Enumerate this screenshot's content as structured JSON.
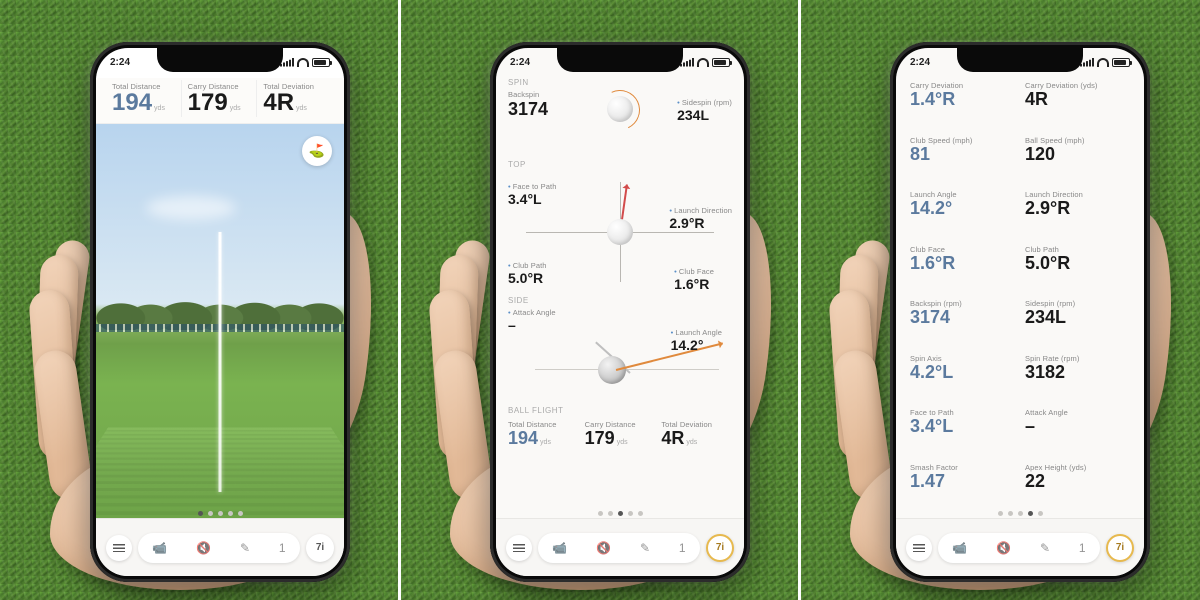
{
  "status": {
    "time": "2:24"
  },
  "dock": {
    "shot_count": "1",
    "club": "7i"
  },
  "phone1": {
    "metrics": [
      {
        "label": "Total Distance",
        "value": "194",
        "unit": "yds"
      },
      {
        "label": "Carry Distance",
        "value": "179",
        "unit": "yds"
      },
      {
        "label": "Total Deviation",
        "value": "4R",
        "unit": "yds"
      }
    ],
    "active_page_index": 0
  },
  "phone2": {
    "sections": {
      "spin": "SPIN",
      "top": "TOP",
      "side": "SIDE",
      "ballflight": "BALL FLIGHT"
    },
    "spin": {
      "backspin": {
        "label": "Backspin",
        "value": "3174"
      },
      "sidespin": {
        "label": "Sidespin (rpm)",
        "value": "234L"
      }
    },
    "top": {
      "face_to_path": {
        "label": "Face to Path",
        "value": "3.4°L"
      },
      "launch_direction": {
        "label": "Launch Direction",
        "value": "2.9°R"
      },
      "club_path": {
        "label": "Club Path",
        "value": "5.0°R"
      },
      "club_face": {
        "label": "Club Face",
        "value": "1.6°R"
      }
    },
    "side": {
      "attack_angle": {
        "label": "Attack Angle",
        "value": "–"
      },
      "launch_angle": {
        "label": "Launch Angle",
        "value": "14.2°"
      }
    },
    "ballflight": {
      "total_distance": {
        "label": "Total Distance",
        "value": "194",
        "unit": "yds"
      },
      "carry_distance": {
        "label": "Carry Distance",
        "value": "179",
        "unit": "yds"
      },
      "total_deviation": {
        "label": "Total Deviation",
        "value": "4R",
        "unit": "yds"
      }
    },
    "active_page_index": 2
  },
  "phone3": {
    "left": [
      {
        "label": "Carry Deviation",
        "value": "1.4°R",
        "dim": true
      },
      {
        "label": "Club Speed (mph)",
        "value": "81",
        "dim": true
      },
      {
        "label": "Launch Angle",
        "value": "14.2°",
        "dim": true
      },
      {
        "label": "Club Face",
        "value": "1.6°R",
        "dim": true
      },
      {
        "label": "Backspin (rpm)",
        "value": "3174",
        "dim": true
      },
      {
        "label": "Spin Axis",
        "value": "4.2°L",
        "dim": true
      },
      {
        "label": "Face to Path",
        "value": "3.4°L",
        "dim": true
      },
      {
        "label": "Smash Factor",
        "value": "1.47",
        "dim": true
      }
    ],
    "right": [
      {
        "label": "Carry Deviation (yds)",
        "value": "4R"
      },
      {
        "label": "Ball Speed (mph)",
        "value": "120"
      },
      {
        "label": "Launch Direction",
        "value": "2.9°R"
      },
      {
        "label": "Club Path",
        "value": "5.0°R"
      },
      {
        "label": "Sidespin (rpm)",
        "value": "234L"
      },
      {
        "label": "Spin Rate (rpm)",
        "value": "3182"
      },
      {
        "label": "Attack Angle",
        "value": "–"
      },
      {
        "label": "Apex Height (yds)",
        "value": "22"
      }
    ],
    "active_page_index": 3
  }
}
